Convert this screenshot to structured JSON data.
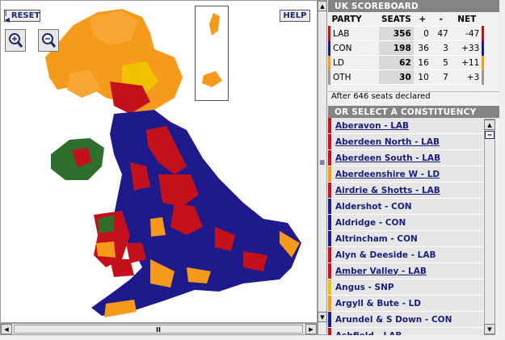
{
  "map": {
    "reset_label": "RESET",
    "help_label": "HELP",
    "hscroll_thumb": "II",
    "colors": {
      "lab": "#c4101a",
      "con": "#1f1a8c",
      "ld": "#f59a1a",
      "oth": "#2f7a2f",
      "snp": "#f2c100",
      "pc": "#2e7a2e"
    }
  },
  "scoreboard": {
    "title": "UK SCOREBOARD",
    "headers": [
      "PARTY",
      "SEATS",
      "+",
      "-",
      "NET"
    ],
    "rows": [
      {
        "party": "LAB",
        "seats": "356",
        "plus": "0",
        "minus": "47",
        "net": "-47",
        "color": "#c4101a"
      },
      {
        "party": "CON",
        "seats": "198",
        "plus": "36",
        "minus": "3",
        "net": "+33",
        "color": "#1f1a8c"
      },
      {
        "party": "LD",
        "seats": "62",
        "plus": "16",
        "minus": "5",
        "net": "+11",
        "color": "#f59a1a"
      },
      {
        "party": "OTH",
        "seats": "30",
        "plus": "10",
        "minus": "7",
        "net": "+3",
        "color": "#999999"
      }
    ],
    "footer": "After 646 seats declared"
  },
  "constituency": {
    "title": "OR SELECT A CONSTITUENCY",
    "items": [
      {
        "label": "Aberavon - LAB",
        "color": "#c4101a",
        "underline": true
      },
      {
        "label": "Aberdeen North - LAB",
        "color": "#c4101a",
        "underline": true
      },
      {
        "label": "Aberdeen South - LAB",
        "color": "#c4101a",
        "underline": true
      },
      {
        "label": "Aberdeenshire W - LD",
        "color": "#f59a1a",
        "underline": true
      },
      {
        "label": "Airdrie & Shotts - LAB",
        "color": "#c4101a",
        "underline": true
      },
      {
        "label": "Aldershot - CON",
        "color": "#1f1a8c",
        "underline": false
      },
      {
        "label": "Aldridge - CON",
        "color": "#1f1a8c",
        "underline": false
      },
      {
        "label": "Altrincham - CON",
        "color": "#1f1a8c",
        "underline": false
      },
      {
        "label": "Alyn & Deeside - LAB",
        "color": "#c4101a",
        "underline": false
      },
      {
        "label": "Amber Valley - LAB",
        "color": "#c4101a",
        "underline": true
      },
      {
        "label": "Angus - SNP",
        "color": "#f2c100",
        "underline": false
      },
      {
        "label": "Argyll & Bute - LD",
        "color": "#f59a1a",
        "underline": false
      },
      {
        "label": "Arundel & S Down - CON",
        "color": "#1f1a8c",
        "underline": false
      },
      {
        "label": "Ashfield - LAB",
        "color": "#c4101a",
        "underline": false
      }
    ]
  }
}
